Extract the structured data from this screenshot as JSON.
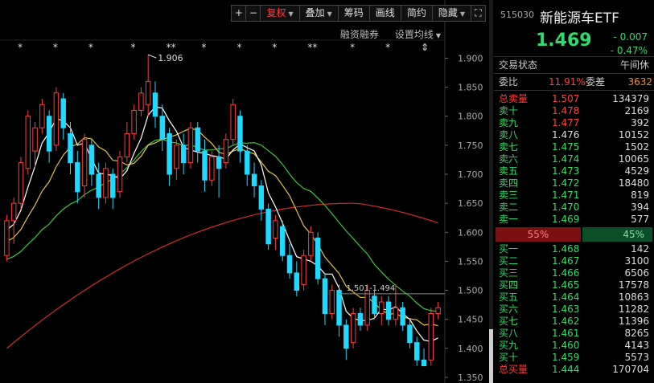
{
  "toolbar": {
    "plus": "+",
    "minus": "−",
    "fuquan": "复权",
    "diejia": "叠加",
    "chouma": "筹码",
    "huaxian": "画线",
    "jianyue": "简约",
    "yincang": "隐藏",
    "fullscreen_icon": "expand-icon"
  },
  "sub_toolbar": {
    "rongzi": "融资融券",
    "shezhi": "设置均线"
  },
  "chart_data": {
    "type": "candlestick",
    "ylim": [
      1.35,
      1.92
    ],
    "y_ticks": [
      "1.900",
      "1.850",
      "1.800",
      "1.750",
      "1.700",
      "1.650",
      "1.600",
      "1.550",
      "1.500",
      "1.450",
      "1.400",
      "1.350"
    ],
    "max_label": "1.906",
    "range_label": "1.501-1.494",
    "range_level": 1.494,
    "star_markers": [
      "*",
      "*",
      "*",
      "*",
      "**",
      "*",
      "*",
      "*",
      "**",
      "*",
      "*",
      "⇕"
    ],
    "candles": [
      [
        1.56,
        1.62,
        1.55,
        1.63
      ],
      [
        1.62,
        1.65,
        1.58,
        1.66
      ],
      [
        1.65,
        1.72,
        1.64,
        1.73
      ],
      [
        1.71,
        1.8,
        1.7,
        1.81
      ],
      [
        1.74,
        1.78,
        1.71,
        1.79
      ],
      [
        1.78,
        1.82,
        1.77,
        1.83
      ],
      [
        1.8,
        1.74,
        1.72,
        1.81
      ],
      [
        1.75,
        1.84,
        1.74,
        1.85
      ],
      [
        1.83,
        1.78,
        1.76,
        1.84
      ],
      [
        1.77,
        1.72,
        1.7,
        1.79
      ],
      [
        1.72,
        1.67,
        1.65,
        1.74
      ],
      [
        1.68,
        1.76,
        1.66,
        1.77
      ],
      [
        1.75,
        1.7,
        1.68,
        1.76
      ],
      [
        1.7,
        1.66,
        1.64,
        1.72
      ],
      [
        1.66,
        1.71,
        1.65,
        1.72
      ],
      [
        1.7,
        1.66,
        1.64,
        1.71
      ],
      [
        1.67,
        1.73,
        1.66,
        1.74
      ],
      [
        1.73,
        1.77,
        1.72,
        1.79
      ],
      [
        1.77,
        1.81,
        1.76,
        1.82
      ],
      [
        1.81,
        1.84,
        1.8,
        1.85
      ],
      [
        1.82,
        1.86,
        1.8,
        1.906
      ],
      [
        1.84,
        1.8,
        1.78,
        1.86
      ],
      [
        1.8,
        1.76,
        1.74,
        1.82
      ],
      [
        1.77,
        1.7,
        1.68,
        1.78
      ],
      [
        1.71,
        1.75,
        1.69,
        1.76
      ],
      [
        1.75,
        1.72,
        1.7,
        1.77
      ],
      [
        1.72,
        1.78,
        1.71,
        1.79
      ],
      [
        1.78,
        1.74,
        1.72,
        1.79
      ],
      [
        1.74,
        1.69,
        1.67,
        1.76
      ],
      [
        1.69,
        1.73,
        1.68,
        1.74
      ],
      [
        1.73,
        1.71,
        1.66,
        1.75
      ],
      [
        1.72,
        1.76,
        1.71,
        1.77
      ],
      [
        1.76,
        1.82,
        1.75,
        1.83
      ],
      [
        1.8,
        1.74,
        1.72,
        1.81
      ],
      [
        1.74,
        1.7,
        1.68,
        1.75
      ],
      [
        1.7,
        1.68,
        1.66,
        1.72
      ],
      [
        1.68,
        1.64,
        1.62,
        1.69
      ],
      [
        1.64,
        1.58,
        1.57,
        1.65
      ],
      [
        1.59,
        1.62,
        1.57,
        1.63
      ],
      [
        1.61,
        1.56,
        1.55,
        1.62
      ],
      [
        1.56,
        1.53,
        1.52,
        1.58
      ],
      [
        1.53,
        1.5,
        1.49,
        1.55
      ],
      [
        1.51,
        1.56,
        1.5,
        1.57
      ],
      [
        1.56,
        1.6,
        1.55,
        1.61
      ],
      [
        1.59,
        1.52,
        1.51,
        1.6
      ],
      [
        1.52,
        1.46,
        1.44,
        1.53
      ],
      [
        1.46,
        1.5,
        1.45,
        1.51
      ],
      [
        1.5,
        1.44,
        1.42,
        1.51
      ],
      [
        1.44,
        1.4,
        1.38,
        1.45
      ],
      [
        1.41,
        1.46,
        1.4,
        1.47
      ],
      [
        1.46,
        1.44,
        1.43,
        1.47
      ],
      [
        1.44,
        1.5,
        1.43,
        1.51
      ],
      [
        1.49,
        1.46,
        1.45,
        1.5
      ],
      [
        1.46,
        1.48,
        1.44,
        1.49
      ],
      [
        1.48,
        1.45,
        1.44,
        1.49
      ],
      [
        1.45,
        1.47,
        1.44,
        1.51
      ],
      [
        1.47,
        1.44,
        1.43,
        1.48
      ],
      [
        1.44,
        1.41,
        1.4,
        1.45
      ],
      [
        1.41,
        1.38,
        1.37,
        1.42
      ],
      [
        1.38,
        1.37,
        1.37,
        1.4
      ],
      [
        1.38,
        1.46,
        1.37,
        1.47
      ],
      [
        1.46,
        1.47,
        1.45,
        1.48
      ]
    ]
  },
  "quote": {
    "code": "515030",
    "name": "新能源车ETF",
    "price": "1.469",
    "change": "- 0.007",
    "change_pct": "- 0.47%",
    "status_label": "交易状态",
    "status_value": "午间休",
    "wb_label": "委比",
    "wb_value": "11.91%",
    "wc_label": "委差",
    "wc_value": "3632"
  },
  "asks": [
    {
      "label": "总卖量",
      "price": "1.507",
      "vol": "134379",
      "price_color": "#ff3b3b"
    },
    {
      "label": "卖十",
      "price": "1.478",
      "vol": "2169",
      "price_color": "#ff4040"
    },
    {
      "label": "卖九",
      "price": "1.477",
      "vol": "392",
      "price_color": "#ff4040"
    },
    {
      "label": "卖八",
      "price": "1.476",
      "vol": "10152",
      "price_color": "#dddddd"
    },
    {
      "label": "卖七",
      "price": "1.475",
      "vol": "1502",
      "price_color": "#2ddc6a"
    },
    {
      "label": "卖六",
      "price": "1.474",
      "vol": "10065",
      "price_color": "#2ddc6a"
    },
    {
      "label": "卖五",
      "price": "1.473",
      "vol": "4529",
      "price_color": "#2ddc6a"
    },
    {
      "label": "卖四",
      "price": "1.472",
      "vol": "18480",
      "price_color": "#2ddc6a"
    },
    {
      "label": "卖三",
      "price": "1.471",
      "vol": "819",
      "price_color": "#2ddc6a"
    },
    {
      "label": "卖二",
      "price": "1.470",
      "vol": "394",
      "price_color": "#2ddc6a"
    },
    {
      "label": "卖一",
      "price": "1.469",
      "vol": "577",
      "price_color": "#2ddc6a"
    }
  ],
  "ratio": {
    "buy": "55%",
    "sell": "45%"
  },
  "bids": [
    {
      "label": "买一",
      "price": "1.468",
      "vol": "142"
    },
    {
      "label": "买二",
      "price": "1.467",
      "vol": "3100"
    },
    {
      "label": "买三",
      "price": "1.466",
      "vol": "6506"
    },
    {
      "label": "买四",
      "price": "1.465",
      "vol": "17578"
    },
    {
      "label": "买五",
      "price": "1.464",
      "vol": "10863"
    },
    {
      "label": "买六",
      "price": "1.463",
      "vol": "11282"
    },
    {
      "label": "买七",
      "price": "1.462",
      "vol": "11396"
    },
    {
      "label": "买八",
      "price": "1.461",
      "vol": "8265"
    },
    {
      "label": "买九",
      "price": "1.460",
      "vol": "4143"
    },
    {
      "label": "买十",
      "price": "1.459",
      "vol": "5573"
    },
    {
      "label": "总买量",
      "price": "1.444",
      "vol": "170704"
    }
  ],
  "colors": {
    "up": "#ff3b3b",
    "down": "#1fd9ff",
    "ma5": "#ffffff",
    "ma10": "#e8c23a",
    "ma20": "#3ec43e",
    "ma60": "#d42a2a"
  }
}
